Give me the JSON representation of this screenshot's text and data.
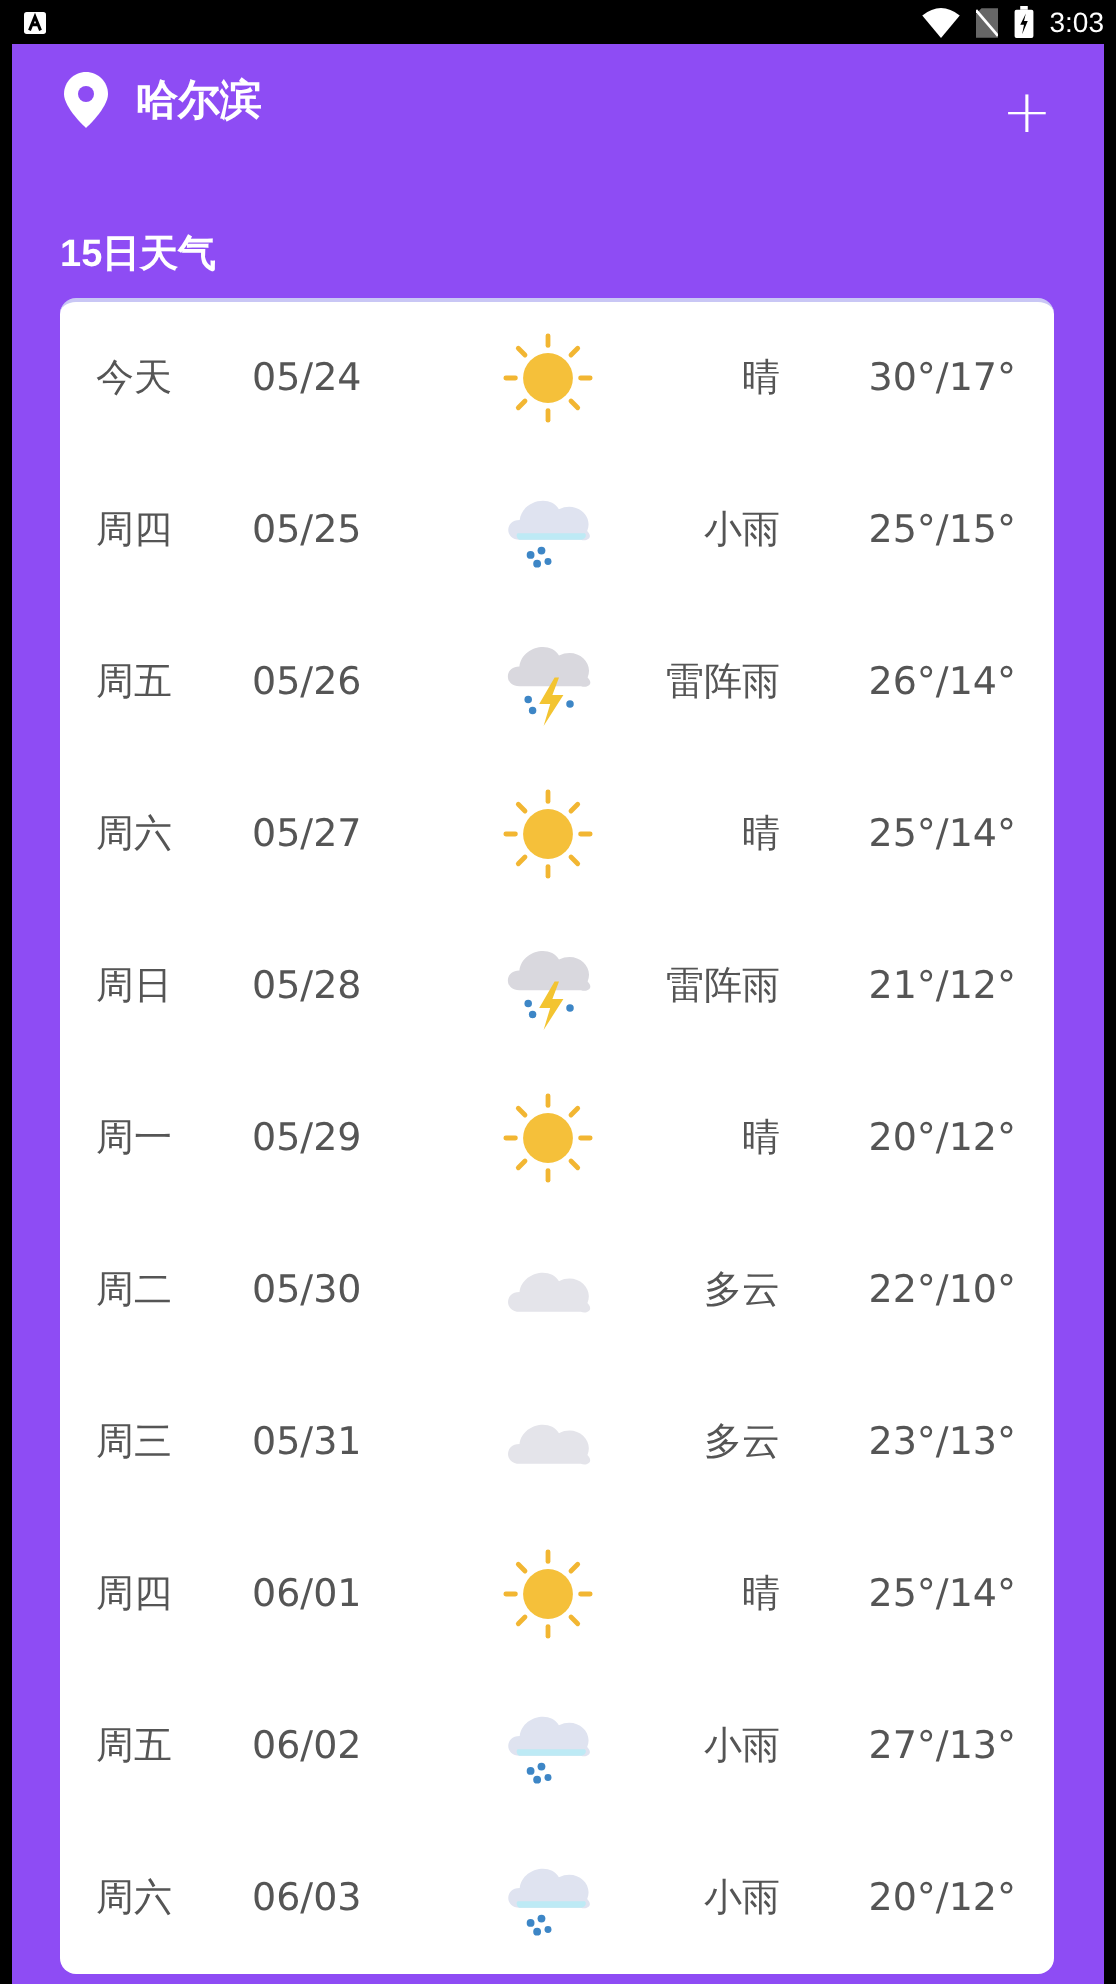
{
  "status_bar": {
    "time": "3:03"
  },
  "header": {
    "city": "哈尔滨",
    "add": "+"
  },
  "section_title": "15日天气",
  "days": [
    {
      "day": "今天",
      "date": "05/24",
      "kind": "sunny",
      "condition": "晴",
      "temp": "30°/17°"
    },
    {
      "day": "周四",
      "date": "05/25",
      "kind": "rain",
      "condition": "小雨",
      "temp": "25°/15°"
    },
    {
      "day": "周五",
      "date": "05/26",
      "kind": "thunder",
      "condition": "雷阵雨",
      "temp": "26°/14°"
    },
    {
      "day": "周六",
      "date": "05/27",
      "kind": "sunny",
      "condition": "晴",
      "temp": "25°/14°"
    },
    {
      "day": "周日",
      "date": "05/28",
      "kind": "thunder",
      "condition": "雷阵雨",
      "temp": "21°/12°"
    },
    {
      "day": "周一",
      "date": "05/29",
      "kind": "sunny",
      "condition": "晴",
      "temp": "20°/12°"
    },
    {
      "day": "周二",
      "date": "05/30",
      "kind": "cloudy",
      "condition": "多云",
      "temp": "22°/10°"
    },
    {
      "day": "周三",
      "date": "05/31",
      "kind": "cloudy",
      "condition": "多云",
      "temp": "23°/13°"
    },
    {
      "day": "周四",
      "date": "06/01",
      "kind": "sunny",
      "condition": "晴",
      "temp": "25°/14°"
    },
    {
      "day": "周五",
      "date": "06/02",
      "kind": "rain",
      "condition": "小雨",
      "temp": "27°/13°"
    },
    {
      "day": "周六",
      "date": "06/03",
      "kind": "rain",
      "condition": "小雨",
      "temp": "20°/12°"
    }
  ]
}
